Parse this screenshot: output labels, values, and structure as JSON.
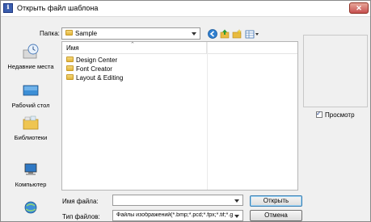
{
  "window": {
    "title": "Открыть файл шаблона",
    "icon_glyph": "ℹ"
  },
  "folder_bar": {
    "label": "Папка:",
    "current": "Sample"
  },
  "places": [
    {
      "label": "Недавние места",
      "icon": "recent-places-icon"
    },
    {
      "label": "Рабочий стол",
      "icon": "desktop-icon"
    },
    {
      "label": "Библиотеки",
      "icon": "libraries-icon"
    },
    {
      "label": "Компьютер",
      "icon": "computer-icon"
    },
    {
      "label": "",
      "icon": "network-icon"
    }
  ],
  "file_list": {
    "column_name": "Имя",
    "items": [
      "Design Center",
      "Font Creator",
      "Layout & Editing"
    ]
  },
  "preview": {
    "checkbox_label": "Просмотр",
    "checked": true
  },
  "filename": {
    "label": "Имя файла:",
    "value": ""
  },
  "filetype": {
    "label": "Тип файлов:",
    "value": "Файлы изображений(*.bmp;*.pcd;*.fpx;*.tif;*.g"
  },
  "buttons": {
    "open": "Открыть",
    "cancel": "Отмена"
  },
  "colors": {
    "folder": "#e2b43c",
    "accent": "#3c7fb1",
    "close": "#c75050"
  }
}
